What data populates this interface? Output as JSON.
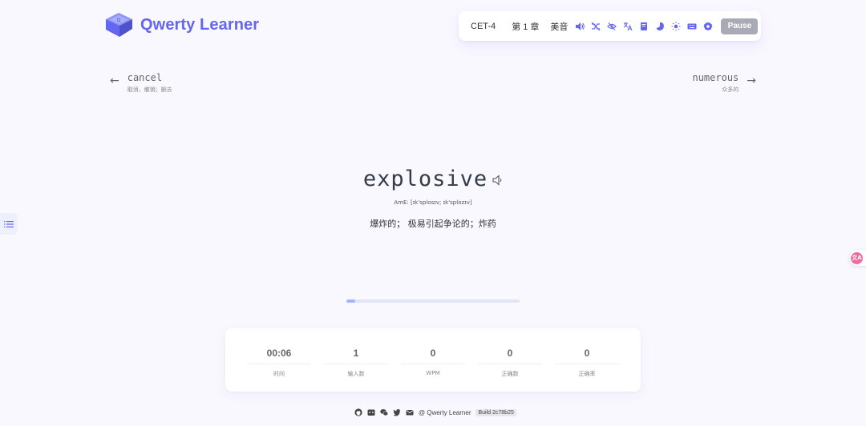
{
  "app": {
    "title": "Qwerty Learner"
  },
  "toolbar": {
    "dictionary": "CET-4",
    "chapter": "第 1 章",
    "accent": "美音",
    "icons": [
      "volume-icon",
      "shuffle-off-icon",
      "eye-off-icon",
      "translate-icon",
      "book-icon",
      "chart-icon",
      "sun-icon",
      "keyboard-icon",
      "gear-icon"
    ],
    "pause_label": "Pause"
  },
  "prev_word": {
    "word": "cancel",
    "translation": "取消，撤销；删去"
  },
  "next_word": {
    "word": "numerous",
    "translation": "众多的"
  },
  "current": {
    "word": "explosive",
    "phonetic": "AmE: [ɪk'splosɪv; ɪk'splozɪv]",
    "translation": "爆炸的； 极易引起争论的；炸药"
  },
  "progress": {
    "percent": 5
  },
  "stats": [
    {
      "value": "00:06",
      "label": "时间"
    },
    {
      "value": "1",
      "label": "输入数"
    },
    {
      "value": "0",
      "label": "WPM"
    },
    {
      "value": "0",
      "label": "正确数"
    },
    {
      "value": "0",
      "label": "正确率"
    }
  ],
  "footer": {
    "credit": "@ Qwerty Learner",
    "build": "Build 2c78b25"
  },
  "colors": {
    "accent": "#6366f1",
    "background": "#f9f8ff",
    "pause": "#a8aab5",
    "progress": "#a5b4fc"
  },
  "translate_float": {
    "glyph": "文A"
  }
}
